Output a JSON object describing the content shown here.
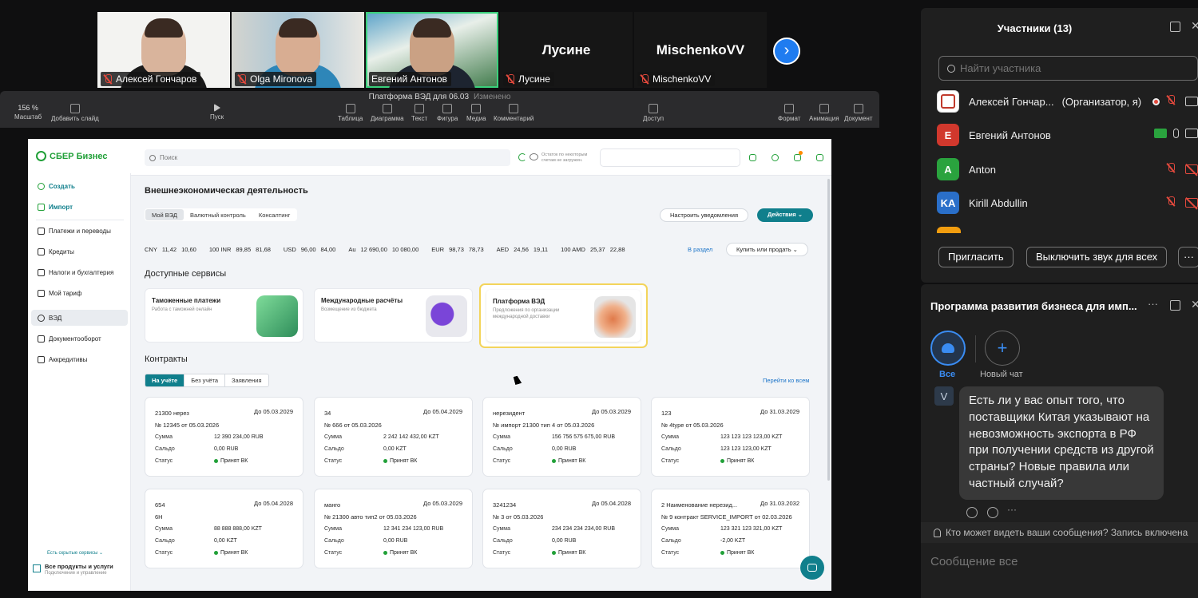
{
  "video": {
    "tiles": [
      {
        "name": "Алексей Гончаров"
      },
      {
        "name": "Olga Mironova"
      },
      {
        "name": "Евгений Антонов"
      },
      {
        "name": "Лусине",
        "big": "Лусине"
      },
      {
        "name": "MischenkoVV",
        "big": "MischenkoVV"
      }
    ],
    "next_icon": "›"
  },
  "keynote": {
    "title": "Платформа ВЭД для 06.03",
    "status": "Изменено",
    "zoom_value": "156 %",
    "tools": [
      "Масштаб",
      "Добавить слайд",
      "Пуск",
      "Таблица",
      "Диаграмма",
      "Текст",
      "Фигура",
      "Медиа",
      "Комментарий",
      "Доступ",
      "Формат",
      "Анимация",
      "Документ"
    ]
  },
  "sber": {
    "logo": "СБЕР Бизнес",
    "search_placeholder": "Поиск",
    "balance_note": "Остаток по некоторым счетам не загружен.",
    "nav": {
      "create": "Создать",
      "import": "Импорт",
      "items": [
        "Платежи и переводы",
        "Кредиты",
        "Налоги и бухгалтерия",
        "Мой тариф",
        "ВЭД",
        "Документооборот",
        "Аккредитивы"
      ],
      "hidden": "Есть скрытые сервисы ⌄",
      "all_title": "Все продукты и услуги",
      "all_sub": "Подключение и управление"
    },
    "page_title": "Внешнеэкономическая деятельность",
    "tabs": [
      "Мой ВЭД",
      "Валютный контроль",
      "Консалтинг"
    ],
    "notify_btn": "Настроить уведомления",
    "actions_btn": "Действия ⌄",
    "rates": [
      {
        "cur": "CNY",
        "a": "11,42",
        "b": "10,60"
      },
      {
        "cur": "100 INR",
        "a": "89,85",
        "b": "81,68"
      },
      {
        "cur": "USD",
        "a": "96,00",
        "b": "84,00"
      },
      {
        "cur": "Au",
        "a": "12 690,00",
        "b": "10 080,00"
      },
      {
        "cur": "EUR",
        "a": "98,73",
        "b": "78,73"
      },
      {
        "cur": "AED",
        "a": "24,56",
        "b": "19,11"
      },
      {
        "cur": "100 AMD",
        "a": "25,37",
        "b": "22,88"
      }
    ],
    "rates_link": "В раздел",
    "buy_sell": "Купить или продать ⌄",
    "services_title": "Доступные сервисы",
    "services": [
      {
        "name": "Таможенные платежи",
        "desc": "Работа с таможней онлайн"
      },
      {
        "name": "Международные расчёты",
        "desc": "Возмещение из бюджета"
      },
      {
        "name": "Платформа ВЭД",
        "desc": "Предложения по организации международной доставки"
      }
    ],
    "contracts_title": "Контракты",
    "contract_tabs": [
      "На учёте",
      "Без учёта",
      "Заявления"
    ],
    "contracts_link": "Перейти ко всем",
    "labels": {
      "sum": "Сумма",
      "saldo": "Сальдо",
      "status": "Статус"
    },
    "contracts": [
      {
        "name": "21300 нерез",
        "until": "До 05.03.2029",
        "num": "№ 12345 от 05.03.2026",
        "sum": "12 390 234,00 RUB",
        "saldo": "0,00 RUB",
        "status": "Принят ВК"
      },
      {
        "name": "34",
        "until": "До 05.04.2029",
        "num": "№ 666 от 05.03.2026",
        "sum": "2 242 142 432,00 KZT",
        "saldo": "0,00 KZT",
        "status": "Принят ВК"
      },
      {
        "name": "нерезидент",
        "until": "До 05.03.2029",
        "num": "№ импорт 21300 тип 4 от 05.03.2026",
        "sum": "156 756 575 675,00 RUB",
        "saldo": "0,00 RUB",
        "status": "Принят ВК"
      },
      {
        "name": "123",
        "until": "До 31.03.2029",
        "num": "№ 4type от 05.03.2026",
        "sum": "123 123 123 123,00 KZT",
        "saldo": "123 123 123,00 KZT",
        "status": "Принят ВК"
      },
      {
        "name": "654",
        "until": "До 05.04.2028",
        "num": "6Н",
        "sum": "88 888 888,00 KZT",
        "saldo": "0,00 KZT",
        "status": "Принят ВК"
      },
      {
        "name": "манго",
        "until": "До 05.03.2029",
        "num": "№ 21300 авто тип2 от 05.03.2026",
        "sum": "12 341 234 123,00 RUB",
        "saldo": "0,00 RUB",
        "status": "Принят ВК"
      },
      {
        "name": "3241234",
        "until": "До 05.04.2028",
        "num": "№ 3 от 05.03.2026",
        "sum": "234 234 234 234,00 RUB",
        "saldo": "0,00 RUB",
        "status": "Принят ВК"
      },
      {
        "name": "2 Наименование нерезид...",
        "until": "До 31.03.2032",
        "num": "№ 9 контракт SERVICE_IMPORT от 02.03.2026",
        "sum": "123 321 123 321,00 KZT",
        "saldo": "-2,00 KZT",
        "status": "Принят ВК"
      }
    ]
  },
  "participants": {
    "title": "Участники (13)",
    "search_placeholder": "Найти участника",
    "list": [
      {
        "initials": "",
        "name": "Алексей Гончар...",
        "tag": "(Организатор, я)",
        "color": "#ffffff"
      },
      {
        "initials": "Е",
        "name": "Евгений Антонов",
        "tag": "",
        "color": "#d1382d"
      },
      {
        "initials": "A",
        "name": "Anton",
        "tag": "",
        "color": "#2aa33e"
      },
      {
        "initials": "KA",
        "name": "Kirill Abdullin",
        "tag": "",
        "color": "#2a6fc9"
      }
    ],
    "invite": "Пригласить",
    "mute_all": "Выключить звук для всех",
    "more": "···"
  },
  "chat": {
    "title": "Программа развития бизнеса для имп...",
    "more": "···",
    "all_label": "Все",
    "new_label": "Новый чат",
    "sender_initial": "V",
    "message": "Есть ли у вас опыт того, что поставщики Китая указывают на невозможность экспорта в РФ при получении средств из другой страны? Новые правила или частный случай?",
    "visibility": "Кто может видеть ваши сообщения? Запись включена",
    "input_placeholder": "Сообщение все"
  },
  "colors": {
    "sber_green": "#21a038",
    "sber_teal": "#107f8c",
    "zoom_blue": "#3a8cf2",
    "highlight": "#f3d45b"
  }
}
